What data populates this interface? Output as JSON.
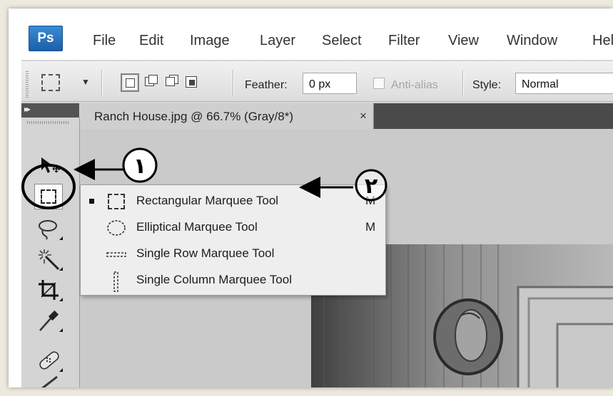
{
  "menubar": {
    "logo": "Ps",
    "items": [
      {
        "label": "File"
      },
      {
        "label": "Edit"
      },
      {
        "label": "Image"
      },
      {
        "label": "Layer"
      },
      {
        "label": "Select"
      },
      {
        "label": "Filter"
      },
      {
        "label": "View"
      },
      {
        "label": "Window"
      },
      {
        "label": "Hel"
      }
    ]
  },
  "options_bar": {
    "feather_label": "Feather:",
    "feather_value": "0 px",
    "antialias_label": "Anti-alias",
    "antialias_checked": false,
    "style_label": "Style:",
    "style_value": "Normal"
  },
  "document": {
    "tab_title": "Ranch House.jpg @ 66.7% (Gray/8*)",
    "close_glyph": "×"
  },
  "tools_panel": {
    "collapse_glyph": "▸▸",
    "tools": [
      {
        "icon": "move-tool-icon"
      },
      {
        "icon": "rectangular-marquee-tool-icon",
        "selected": true
      },
      {
        "icon": "lasso-tool-icon"
      },
      {
        "icon": "quick-selection-tool-icon"
      },
      {
        "icon": "crop-tool-icon"
      },
      {
        "icon": "eyedropper-tool-icon"
      },
      {
        "icon": "spot-healing-brush-tool-icon"
      },
      {
        "icon": "brush-tool-icon"
      }
    ]
  },
  "flyout": {
    "items": [
      {
        "label": "Rectangular Marquee Tool",
        "shortcut": "M",
        "icon": "rectangular-marquee-icon",
        "active": true
      },
      {
        "label": "Elliptical Marquee Tool",
        "shortcut": "M",
        "icon": "elliptical-marquee-icon",
        "active": false
      },
      {
        "label": "Single Row Marquee Tool",
        "shortcut": "",
        "icon": "single-row-marquee-icon",
        "active": false
      },
      {
        "label": "Single Column Marquee Tool",
        "shortcut": "",
        "icon": "single-column-marquee-icon",
        "active": false
      }
    ]
  },
  "annotations": {
    "marker_1": "١",
    "marker_2": "٢"
  },
  "colors": {
    "ps_logo_blue": "#1b5fa8",
    "panel_dark": "#535353",
    "flyout_bg": "#eeeeee"
  }
}
